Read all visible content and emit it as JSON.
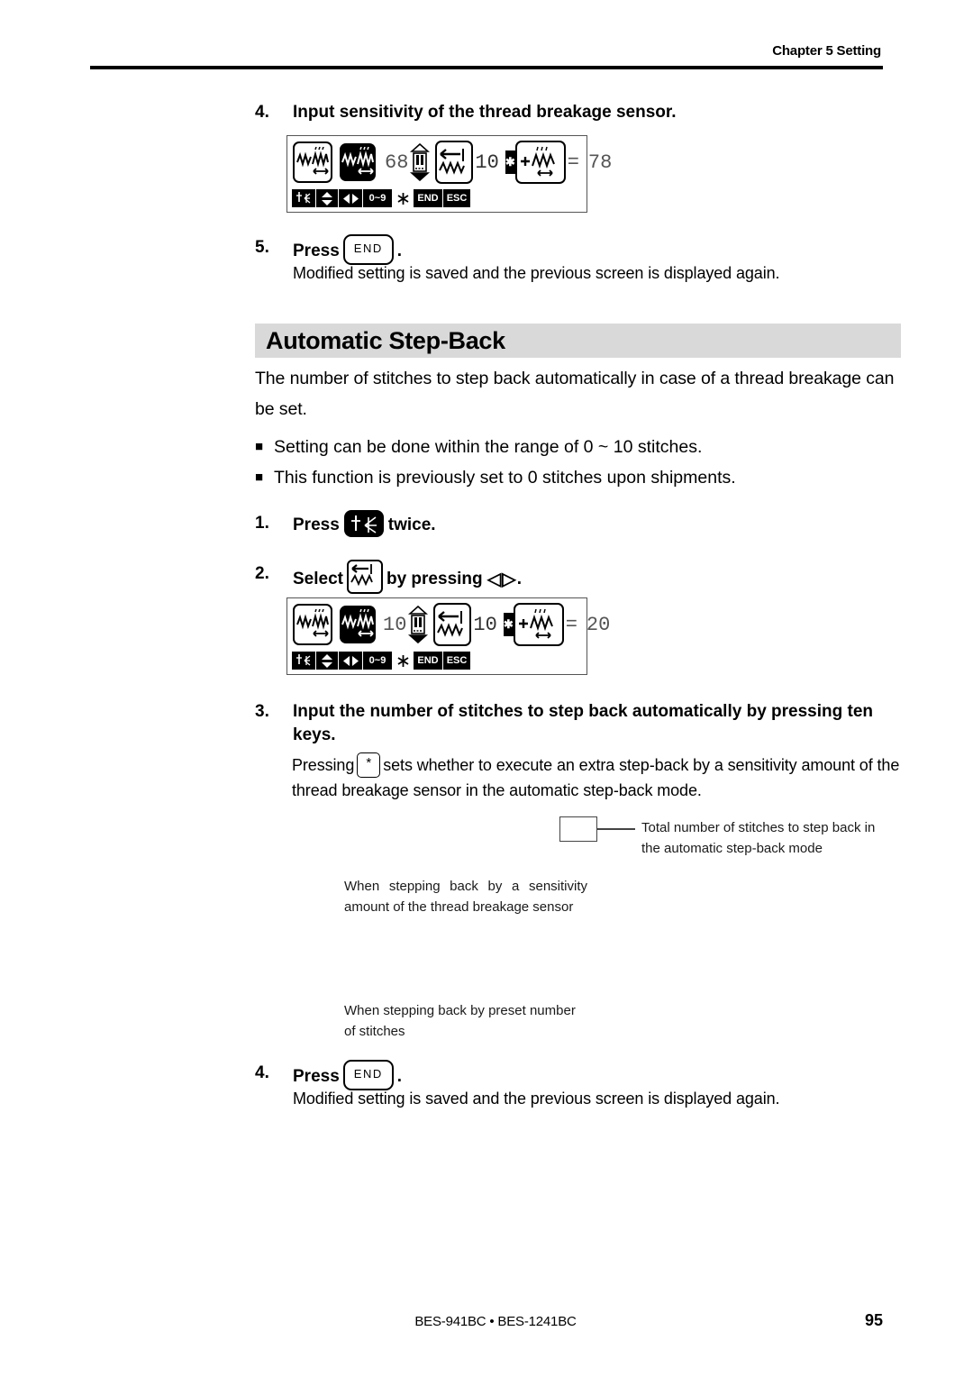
{
  "header": {
    "chapter": "Chapter 5 Setting"
  },
  "step4_top": {
    "number": "4.",
    "title": "Input sensitivity of the thread breakage sensor."
  },
  "lcd_top": {
    "value_sensitivity": "68",
    "value_stitches": "10",
    "equals": "=",
    "value_total": "78",
    "plus": "+",
    "bottom_bar": {
      "zero_to_nine": "0~9",
      "asterisk": "*",
      "end": "END",
      "esc": "ESC"
    }
  },
  "step5_top": {
    "number": "5.",
    "press_label": "Press",
    "key_end": "END",
    "period": ".",
    "description": "Modified setting is saved and the previous screen is displayed again."
  },
  "section": {
    "title": "Automatic Step-Back"
  },
  "intro": {
    "paragraph": "The number of stitches to step back automatically in case of a thread breakage can be set.",
    "bullets": [
      "Setting can be done within the range of 0 ~ 10 stitches.",
      "This function is previously set to 0 stitches upon shipments."
    ],
    "bullet_mark": "■"
  },
  "step1": {
    "number": "1.",
    "press_label": "Press",
    "suffix": "twice."
  },
  "step2": {
    "number": "2.",
    "select_label": "Select",
    "by_pressing_label": "by pressing",
    "arrows": "◁▷",
    "period": "."
  },
  "lcd_bottom": {
    "value_sensitivity": "10",
    "value_stitches": "10",
    "equals": "=",
    "value_total": "20",
    "plus": "+",
    "bottom_bar": {
      "zero_to_nine": "0~9",
      "asterisk": "*",
      "end": "END",
      "esc": "ESC"
    }
  },
  "step3": {
    "number": "3.",
    "title": "Input the number of stitches to step back automatically by pressing ten keys.",
    "desc_prefix": "Pressing",
    "key_star": "*",
    "desc_suffix": "sets whether to execute an extra step-back by a sensitivity amount of the thread breakage sensor in the automatic step-back mode."
  },
  "callouts": {
    "total": "Total number of stitches to step back in the automatic step-back mode",
    "sensitivity": "When stepping back by a sensitivity amount of the thread breakage sensor",
    "preset": "When stepping back by preset number of stitches"
  },
  "step4_bottom": {
    "number": "4.",
    "press_label": "Press",
    "key_end": "END",
    "period": ".",
    "description": "Modified setting is saved and the previous screen is displayed again."
  },
  "footer": {
    "models": "BES-941BC • BES-1241BC",
    "page": "95"
  }
}
